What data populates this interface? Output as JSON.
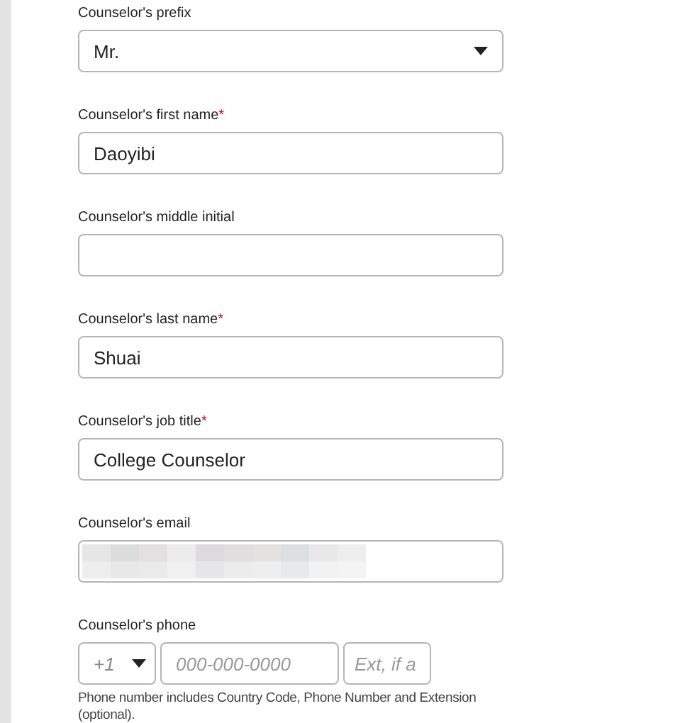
{
  "fields": [
    {
      "kind": "select",
      "label": "Counselor's prefix",
      "value": "Mr."
    },
    {
      "kind": "text",
      "label": "Counselor's first name",
      "required_mark": "*",
      "value": "Daoyibi"
    },
    {
      "kind": "text",
      "label": "Counselor's middle initial"
    },
    {
      "kind": "text",
      "label": "Counselor's last name",
      "required_mark": "*",
      "value": "Shuai"
    },
    {
      "kind": "text",
      "label": "Counselor's job title",
      "required_mark": "*",
      "value": "College Counselor"
    },
    {
      "kind": "text",
      "label": "Counselor's email",
      "redacted": true
    },
    {
      "kind": "phone",
      "label": "Counselor's phone",
      "country_code": "+1",
      "number_placeholder": "000-000-0000",
      "extension_placeholder": "Ext, if a",
      "help": "Phone number includes Country Code, Phone Number and Extension (optional)."
    }
  ]
}
